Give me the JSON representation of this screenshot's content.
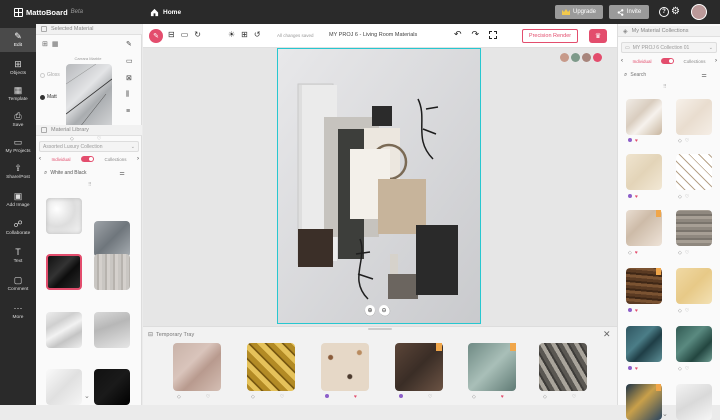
{
  "app": {
    "name": "MattoBoard",
    "badge": "Beta",
    "home_label": "Home",
    "upgrade_label": "Upgrade",
    "invite_label": "Invite"
  },
  "rail": [
    {
      "label": "Edit",
      "icon": "edit-icon"
    },
    {
      "label": "Objects",
      "icon": "objects-icon"
    },
    {
      "label": "Template",
      "icon": "template-icon"
    },
    {
      "label": "Save",
      "icon": "save-icon"
    },
    {
      "label": "My Projects",
      "icon": "folder-icon"
    },
    {
      "label": "Share/Post",
      "icon": "share-icon"
    },
    {
      "label": "Add Image",
      "icon": "image-icon"
    },
    {
      "label": "Collaborate",
      "icon": "collaborate-icon"
    },
    {
      "label": "Text",
      "icon": "text-icon"
    },
    {
      "label": "Comment",
      "icon": "comment-icon"
    },
    {
      "label": "More",
      "icon": "more-icon"
    }
  ],
  "left": {
    "selected_material_title": "Selected Material",
    "material_library_title": "Material Library",
    "collection_select": "Assorted Luxury Collection",
    "toggle_left": "Individual",
    "toggle_right": "Collections",
    "search_value": "White and Black",
    "options": {
      "gloss": "Gloss",
      "matt": "Matt"
    },
    "selected_caption": "Carrara Marble"
  },
  "toolbar": {
    "saved_status": "All changes saved",
    "project_title": "MY PROJ 6 - Living Room Materials",
    "render_label": "Precision Render"
  },
  "tray": {
    "title": "Temporary Tray"
  },
  "right": {
    "title": "My Material Collections",
    "collection_select": "MY PROJ 6 Collection 01",
    "toggle_left": "Individual",
    "toggle_right": "Collections",
    "search_placeholder": "Search"
  },
  "colors": {
    "accent": "#e34d6d",
    "board_border": "#27c7d0",
    "dark": "#2a2a2a",
    "gold": "#f2c94c"
  }
}
